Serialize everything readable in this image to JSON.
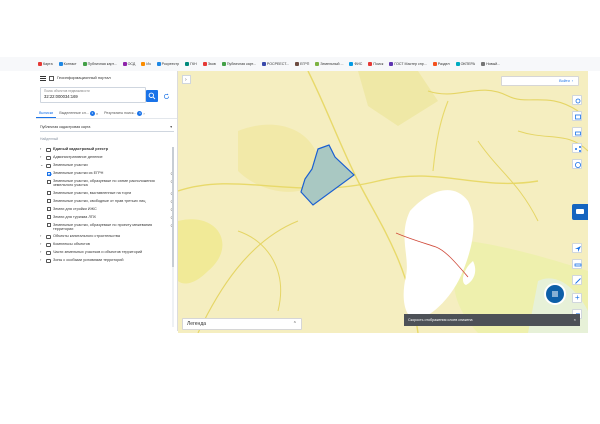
{
  "bookmarks": [
    {
      "label": "Карта",
      "color": "#e53935"
    },
    {
      "label": "Контакт",
      "color": "#1e88e5"
    },
    {
      "label": "Публичная карт...",
      "color": "#43a047"
    },
    {
      "label": "ОСД",
      "color": "#8e24aa"
    },
    {
      "label": "Из",
      "color": "#fb8c00"
    },
    {
      "label": "Росреестр",
      "color": "#1e88e5"
    },
    {
      "label": "ГКН",
      "color": "#00897b"
    },
    {
      "label": "Эков",
      "color": "#e53935"
    },
    {
      "label": "Публичная карт...",
      "color": "#43a047"
    },
    {
      "label": "РОСРЕЕСТ...",
      "color": "#3949ab"
    },
    {
      "label": "ЕГРП",
      "color": "#6d4c41"
    },
    {
      "label": "Земельный ...",
      "color": "#7cb342"
    },
    {
      "label": "ФИС",
      "color": "#039be5"
    },
    {
      "label": "Поиск",
      "color": "#e53935"
    },
    {
      "label": "ГОСТ Мастер спр...",
      "color": "#5e35b1"
    },
    {
      "label": "Раздел",
      "color": "#f4511e"
    },
    {
      "label": "ОКПЕРА",
      "color": "#00acc1"
    },
    {
      "label": "Новый...",
      "color": "#757575"
    }
  ],
  "panel": {
    "title": "Геоинформационный портал",
    "search_label": "Поиск объектов недвижимости",
    "search_value": "32:22:000034:169",
    "tabs": [
      {
        "label": "Выписки",
        "badge": ""
      },
      {
        "label": "Выделенные сл...",
        "badge": "1"
      },
      {
        "label": "Результаты поиск...",
        "badge": "1"
      }
    ],
    "select_value": "Публичная кадастровая карта",
    "sublabel": "Найденный"
  },
  "tree": [
    {
      "type": "folder",
      "level": 0,
      "label": "Единый кадастровый реестр",
      "bold": true,
      "chev": "›"
    },
    {
      "type": "folder",
      "level": 0,
      "label": "Административное деление",
      "bold": false,
      "chev": "›"
    },
    {
      "type": "folder",
      "level": 0,
      "label": "Земельные участки",
      "bold": false,
      "chev": "⌄"
    },
    {
      "type": "check",
      "level": 1,
      "label": "Земельные участки из ЕГРН",
      "checked": true,
      "icon": "⟳"
    },
    {
      "type": "check",
      "level": 1,
      "label": "Земельные участки, образуемые по схеме расположения земельного участка",
      "checked": false,
      "icon": "⟳"
    },
    {
      "type": "check",
      "level": 1,
      "label": "Земельные участки, выставленные на торги",
      "checked": false,
      "icon": "⟳"
    },
    {
      "type": "check",
      "level": 1,
      "label": "Земельные участки, свободные от прав третьих лиц",
      "checked": false,
      "icon": "⟳"
    },
    {
      "type": "check",
      "level": 1,
      "label": "Земли для стройки ИЖС",
      "checked": false,
      "icon": "⟳"
    },
    {
      "type": "check",
      "level": 1,
      "label": "Земли для туризма ЛПХ",
      "checked": false,
      "icon": "⟳"
    },
    {
      "type": "check",
      "level": 1,
      "label": "Земельные участки, образуемые по проекту межевания территории",
      "checked": false,
      "icon": "⟳"
    },
    {
      "type": "folder",
      "level": 0,
      "label": "Объекты капитального строительства",
      "bold": false,
      "chev": "›"
    },
    {
      "type": "folder",
      "level": 0,
      "label": "Комплексы объектов",
      "bold": false,
      "chev": "›"
    },
    {
      "type": "folder",
      "level": 0,
      "label": "Части земельных участков и объектов территорий",
      "bold": false,
      "chev": "›"
    },
    {
      "type": "folder",
      "level": 0,
      "label": "Зоны с особыми условиями территорий",
      "bold": false,
      "chev": "›"
    }
  ],
  "map": {
    "top_button": "Войти",
    "legend": "Легенда",
    "toast": "Скорость отображения слоев снижена",
    "parcel_fill": "#a9c8c2",
    "parcel_stroke": "#1a5fd1"
  }
}
